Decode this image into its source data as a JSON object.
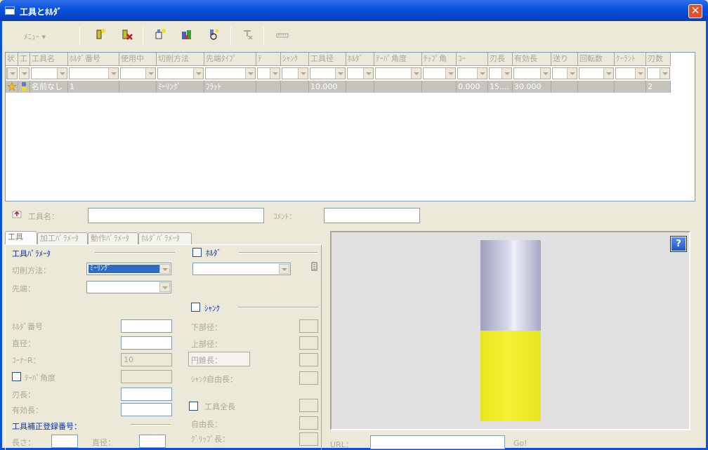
{
  "window": {
    "title": "工具とﾎﾙﾀﾞ",
    "close_label": "✕"
  },
  "toolbar": {
    "menu_label": "ﾒﾆｭｰ  ▾",
    "icons": [
      "new-tool-icon",
      "delete-tool-icon",
      "add-holder-icon",
      "copy-icon",
      "refresh-icon",
      "clear-icon",
      "ruler-icon"
    ]
  },
  "grid": {
    "columns": [
      "状",
      "工",
      "工具名",
      "ﾎﾙﾀﾞ番号",
      "使用中",
      "切削方法",
      "先端ﾀｲﾌﾟ",
      "ﾃ",
      "ｼｬﾝｸ",
      "工具径",
      "ﾎﾙﾀﾞ",
      "ﾃｰﾊﾟ角度",
      "ﾁｯﾌﾟ角",
      "ｺｰ",
      "刃長",
      "有効長",
      "送り",
      "回転数",
      "ｸｰﾗﾝﾄ",
      "刃数"
    ],
    "row": [
      "",
      "",
      "名前なし",
      "1",
      "",
      "ﾐｰﾘﾝｸﾞ",
      "ﾌﾗｯﾄ",
      "",
      "",
      "10.000",
      "",
      "",
      "",
      "0.000",
      "15....",
      "30.000",
      "",
      "",
      "",
      "2"
    ]
  },
  "tool_name": {
    "label": "工具名：",
    "comment_label": "ｺﾒﾝﾄ："
  },
  "tabs": [
    "工具",
    "加工ﾊﾟﾗﾒｰﾀ",
    "動作ﾊﾟﾗﾒｰﾀ",
    "ﾎﾙﾀﾞﾊﾟﾗﾒｰﾀ"
  ],
  "tool_params": {
    "heading": "工具ﾊﾟﾗﾒｰﾀ",
    "cut_method_label": "切削方法：",
    "cut_method_value": "ﾐｰﾘﾝｸﾞ",
    "tip_label": "先端：",
    "holder_no_label": "ﾎﾙﾀﾞ番号",
    "diameter_label": "直径：",
    "corner_r_label": "ｺｰﾅｰR：",
    "corner_r_value": "10",
    "taper_label": "ﾃｰﾊﾟ角度",
    "blade_len_label": "刃長：",
    "eff_len_label": "有効長：",
    "comp_heading": "工具補正登録番号：",
    "length_label": "長さ：",
    "dia2_label": "直径："
  },
  "holder": {
    "label": "ﾎﾙﾀﾞ",
    "shank_label": "ｼｬﾝｸ",
    "lower_dia": "下部径：",
    "upper_dia": "上部径：",
    "cone_len": "円錐長：",
    "shank_free": "ｼｬﾝｸ自由長：",
    "total_len": "工具全長",
    "free_len": "自由長：",
    "grip_len": "ｸﾞﾘｯﾌﾟ長："
  },
  "preview": {
    "help": "?",
    "url_label": "URL：",
    "go_label": "Go!"
  },
  "colors": {
    "tool_top": "#b7b9d0",
    "tool_bottom": "#f2ef27",
    "preview_bg": "#e1e1e1",
    "title_bar": "#0a54e0"
  }
}
